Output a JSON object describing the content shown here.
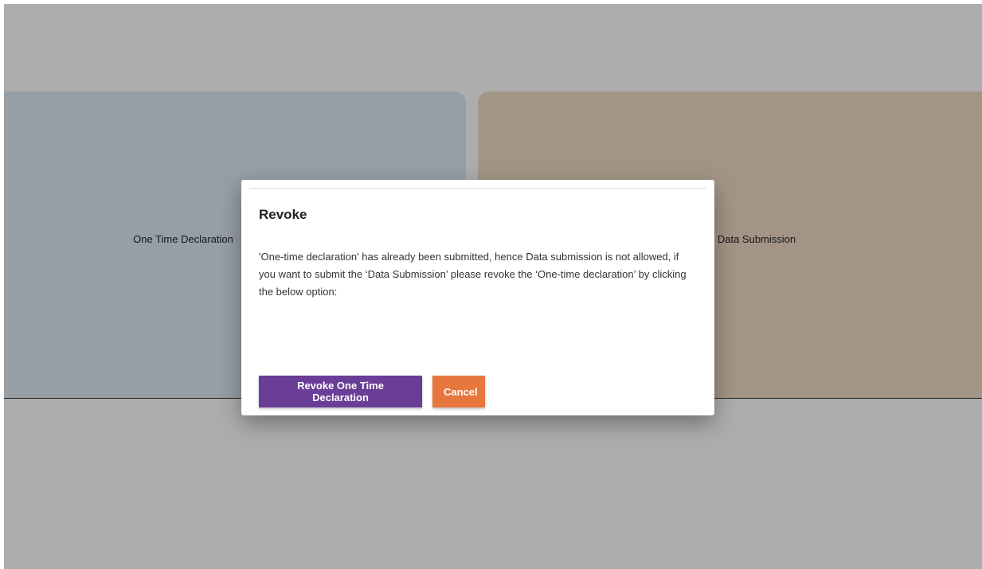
{
  "cards": {
    "left_label": "One Time Declaration",
    "right_label": "Data Submission"
  },
  "modal": {
    "title": "Revoke",
    "message": "'One-time declaration' has already been submitted, hence Data submission is not allowed, if you want to submit the ‘Data Submission’ please revoke the ‘One-time declaration’ by clicking the below option:",
    "revoke_label": "Revoke One Time Declaration",
    "cancel_label": "Cancel"
  },
  "colors": {
    "revoke_button": "#6a3e96",
    "cancel_button": "#e8773e",
    "left_card": "#dde9f5",
    "right_card": "#f0dcc6"
  }
}
